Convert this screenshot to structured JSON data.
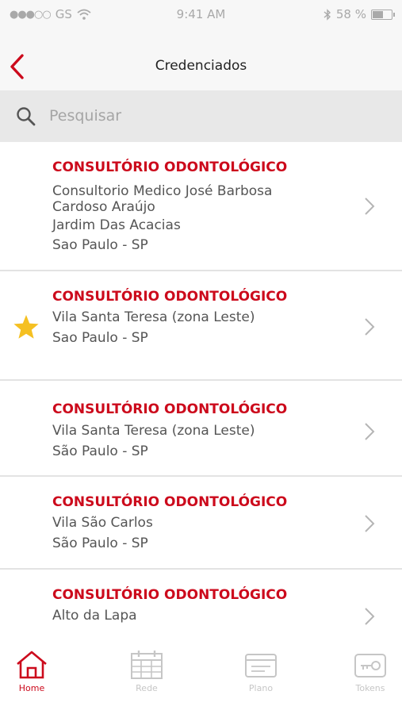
{
  "status_bar": {
    "carrier": "GS",
    "time": "9:41 AM",
    "battery": "58 %",
    "battery_level": 0.58
  },
  "nav": {
    "title": "Credenciados",
    "back_icon": "chevron-left-icon"
  },
  "search": {
    "placeholder": "Pesquisar",
    "value": ""
  },
  "items": [
    {
      "title": "CONSULTÓRIO ODONTOLÓGICO",
      "lines": [
        "Consultorio Medico José Barbosa",
        "Cardoso Araújo",
        "Jardim Das Acacias",
        "Sao Paulo - SP"
      ],
      "favorite": false
    },
    {
      "title": "CONSULTÓRIO ODONTOLÓGICO",
      "lines": [
        "Vila Santa Teresa (zona Leste)",
        "Sao Paulo - SP"
      ],
      "favorite": true
    },
    {
      "title": "CONSULTÓRIO ODONTOLÓGICO",
      "lines": [
        "Vila Santa Teresa (zona Leste)",
        "São Paulo - SP"
      ],
      "favorite": false
    },
    {
      "title": "CONSULTÓRIO ODONTOLÓGICO",
      "lines": [
        "Vila São Carlos",
        "São Paulo - SP"
      ],
      "favorite": false
    },
    {
      "title": "CONSULTÓRIO ODONTOLÓGICO",
      "lines": [
        "Alto da Lapa"
      ],
      "favorite": false
    }
  ],
  "tabs": [
    {
      "label": "Home",
      "icon": "home-icon",
      "active": true
    },
    {
      "label": "Rede",
      "icon": "calendar-grid-icon",
      "active": false
    },
    {
      "label": "Plano",
      "icon": "card-icon",
      "active": false
    },
    {
      "label": "Tokens",
      "icon": "key-icon",
      "active": false
    }
  ],
  "colors": {
    "accent": "#cc0a1c",
    "star": "#f5c022",
    "inactive_tab": "#c6c6c6"
  }
}
